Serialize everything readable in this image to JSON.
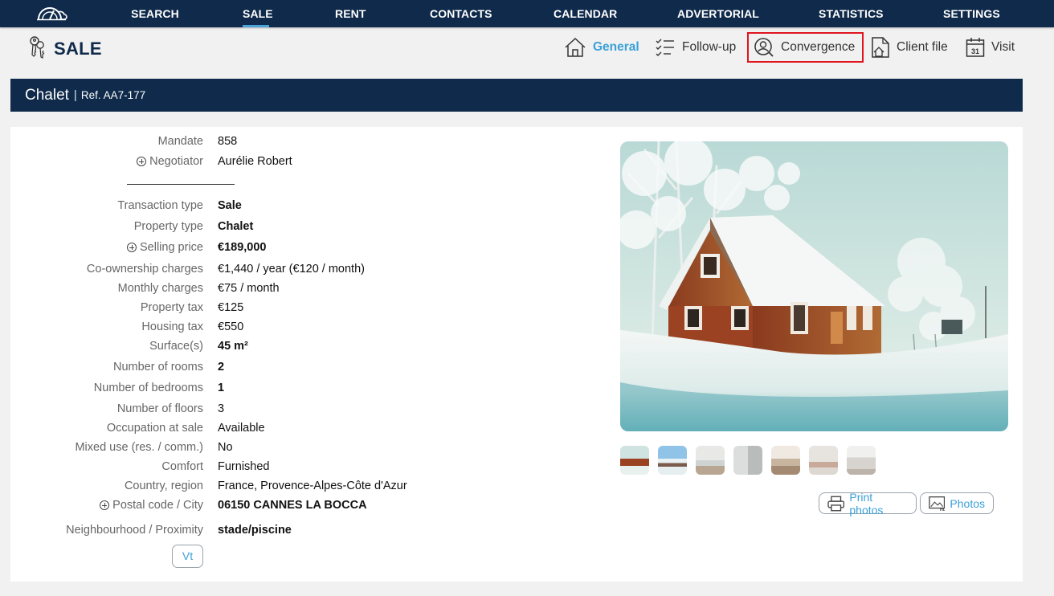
{
  "nav": {
    "items": [
      {
        "label": "SEARCH"
      },
      {
        "label": "SALE",
        "active": true
      },
      {
        "label": "RENT"
      },
      {
        "label": "CONTACTS"
      },
      {
        "label": "CALENDAR"
      },
      {
        "label": "ADVERTORIAL"
      },
      {
        "label": "STATISTICS"
      },
      {
        "label": "SETTINGS"
      }
    ]
  },
  "page": {
    "title": "SALE",
    "tabs": [
      {
        "label": "General",
        "icon": "home-icon",
        "active": true
      },
      {
        "label": "Follow-up",
        "icon": "checklist-icon"
      },
      {
        "label": "Convergence",
        "icon": "user-search-icon",
        "highlighted": true
      },
      {
        "label": "Client file",
        "icon": "house-document-icon"
      },
      {
        "label": "Visit",
        "icon": "calendar-icon",
        "calendar_day": "31"
      }
    ]
  },
  "listing": {
    "type": "Chalet",
    "ref": "Ref. AA7-177",
    "mandate": {
      "label": "Mandate",
      "value": "858"
    },
    "negotiator": {
      "label": "Negotiator",
      "value": "Aurélie Robert"
    },
    "fields": [
      {
        "label": "Transaction type",
        "value": "Sale",
        "bold": true
      },
      {
        "label": "Property type",
        "value": "Chalet",
        "bold": true
      },
      {
        "label": "Selling price",
        "value": "€189,000",
        "bold": true,
        "expand": true
      },
      {
        "label": "Co-ownership charges",
        "value": "€1,440 / year (€120 / month)"
      },
      {
        "label": "Monthly charges",
        "value": "€75 / month"
      },
      {
        "label": "Property tax",
        "value": "€125"
      },
      {
        "label": "Housing tax",
        "value": "€550"
      },
      {
        "label": "Surface(s)",
        "value": "45 m²",
        "bold": true
      },
      {
        "label": "Number of rooms",
        "value": "2",
        "bold": true
      },
      {
        "label": "Number of bedrooms",
        "value": "1",
        "bold": true
      },
      {
        "label": "Number of floors",
        "value": "3"
      },
      {
        "label": "Occupation at sale",
        "value": "Available"
      },
      {
        "label": "Mixed use (res. / comm.)",
        "value": "No"
      },
      {
        "label": "Comfort",
        "value": "Furnished"
      },
      {
        "label": "Country, region",
        "value": "France, Provence-Alpes-Côte d'Azur"
      },
      {
        "label": "Postal code / City",
        "value": "06150 CANNES LA BOCCA",
        "bold": true,
        "expand": true
      },
      {
        "label": "Neighbourhood / Proximity",
        "value": "stade/piscine",
        "bold": true
      }
    ],
    "vt_button": "Vt"
  },
  "media": {
    "thumbnail_count": 7,
    "print_photos_label": "Print photos",
    "photos_label": "Photos"
  }
}
